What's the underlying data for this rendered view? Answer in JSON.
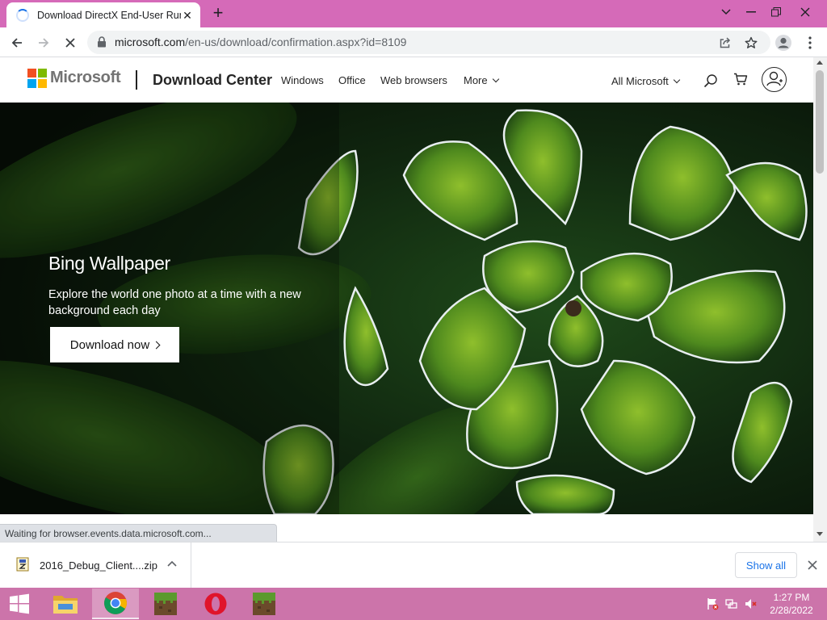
{
  "browser": {
    "tab": {
      "title": "Download DirectX End-User Runtime Web Installer"
    },
    "url": {
      "host": "microsoft.com",
      "path": "/en-us/download/confirmation.aspx?id=8109"
    }
  },
  "site": {
    "brand": "Microsoft",
    "section_title": "Download Center",
    "nav": [
      "Windows",
      "Office",
      "Web browsers",
      "More"
    ],
    "all_microsoft": "All Microsoft"
  },
  "hero": {
    "title": "Bing Wallpaper",
    "description": "Explore the world one photo at a time with a new background each day",
    "cta": "Download now"
  },
  "status_text": "Waiting for browser.events.data.microsoft.com...",
  "download_shelf": {
    "file_name": "2016_Debug_Client....zip",
    "show_all": "Show all"
  },
  "taskbar": {
    "time": "1:27 PM",
    "date": "2/28/2022"
  },
  "colors": {
    "tabstrip": "#d56ab8",
    "taskbar": "#cc74aa",
    "ms_red": "#f25022",
    "ms_green": "#7fba00",
    "ms_blue": "#00a4ef",
    "ms_yellow": "#ffb900"
  }
}
